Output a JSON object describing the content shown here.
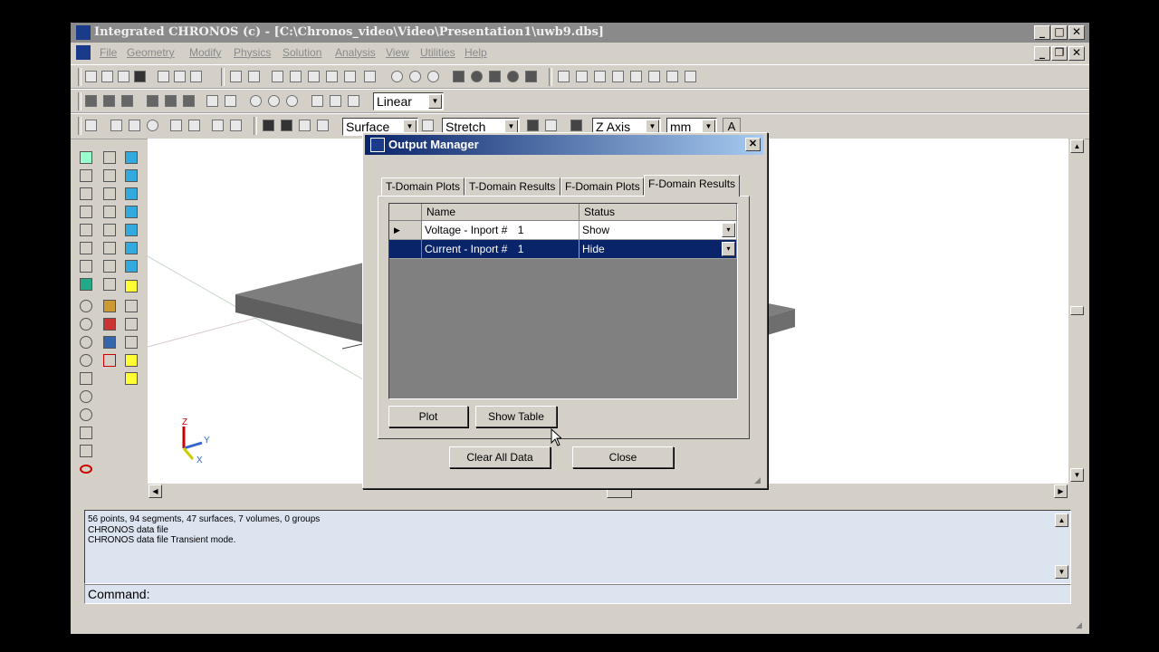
{
  "window": {
    "title": "Integrated CHRONOS (c) - [C:\\Chronos_video\\Video\\Presentation1\\uwb9.dbs]"
  },
  "menu": [
    "File",
    "Geometry",
    "Modify",
    "Physics",
    "Solution",
    "Analysis",
    "View",
    "Utilities",
    "Help"
  ],
  "toolbar": {
    "interp_select": "Linear",
    "surface_select": "Surface",
    "stretch_select": "Stretch",
    "axis_select": "Z Axis",
    "units_select": "mm",
    "text_tool": "A"
  },
  "axes_indicator": {
    "z": "Z",
    "y": "Y",
    "x": "X"
  },
  "dialog": {
    "title": "Output Manager",
    "close_glyph": "✕",
    "tabs": [
      "T-Domain Plots",
      "T-Domain Results",
      "F-Domain Plots",
      "F-Domain Results"
    ],
    "active_tab": "F-Domain Results",
    "grid": {
      "columns": [
        "Name",
        "Status"
      ],
      "rows": [
        {
          "name": "Voltage - Inport #",
          "num": "1",
          "status": "Show"
        },
        {
          "name": "Current - Inport #",
          "num": "1",
          "status": "Hide"
        }
      ]
    },
    "buttons": {
      "plot": "Plot",
      "show_table": "Show Table",
      "clear_all": "Clear All Data",
      "close": "Close"
    }
  },
  "console": {
    "lines": [
      "56 points,   94 segments,   47 surfaces,   7 volumes,   0 groups",
      "CHRONOS data file",
      "CHRONOS data file Transient mode."
    ],
    "command_label": "Command:"
  },
  "colors": {
    "dialog_title_start": "#0a246a",
    "dialog_title_end": "#a6caf0",
    "selected_row": "#0a246a",
    "console_bg": "#dbe4ef"
  }
}
